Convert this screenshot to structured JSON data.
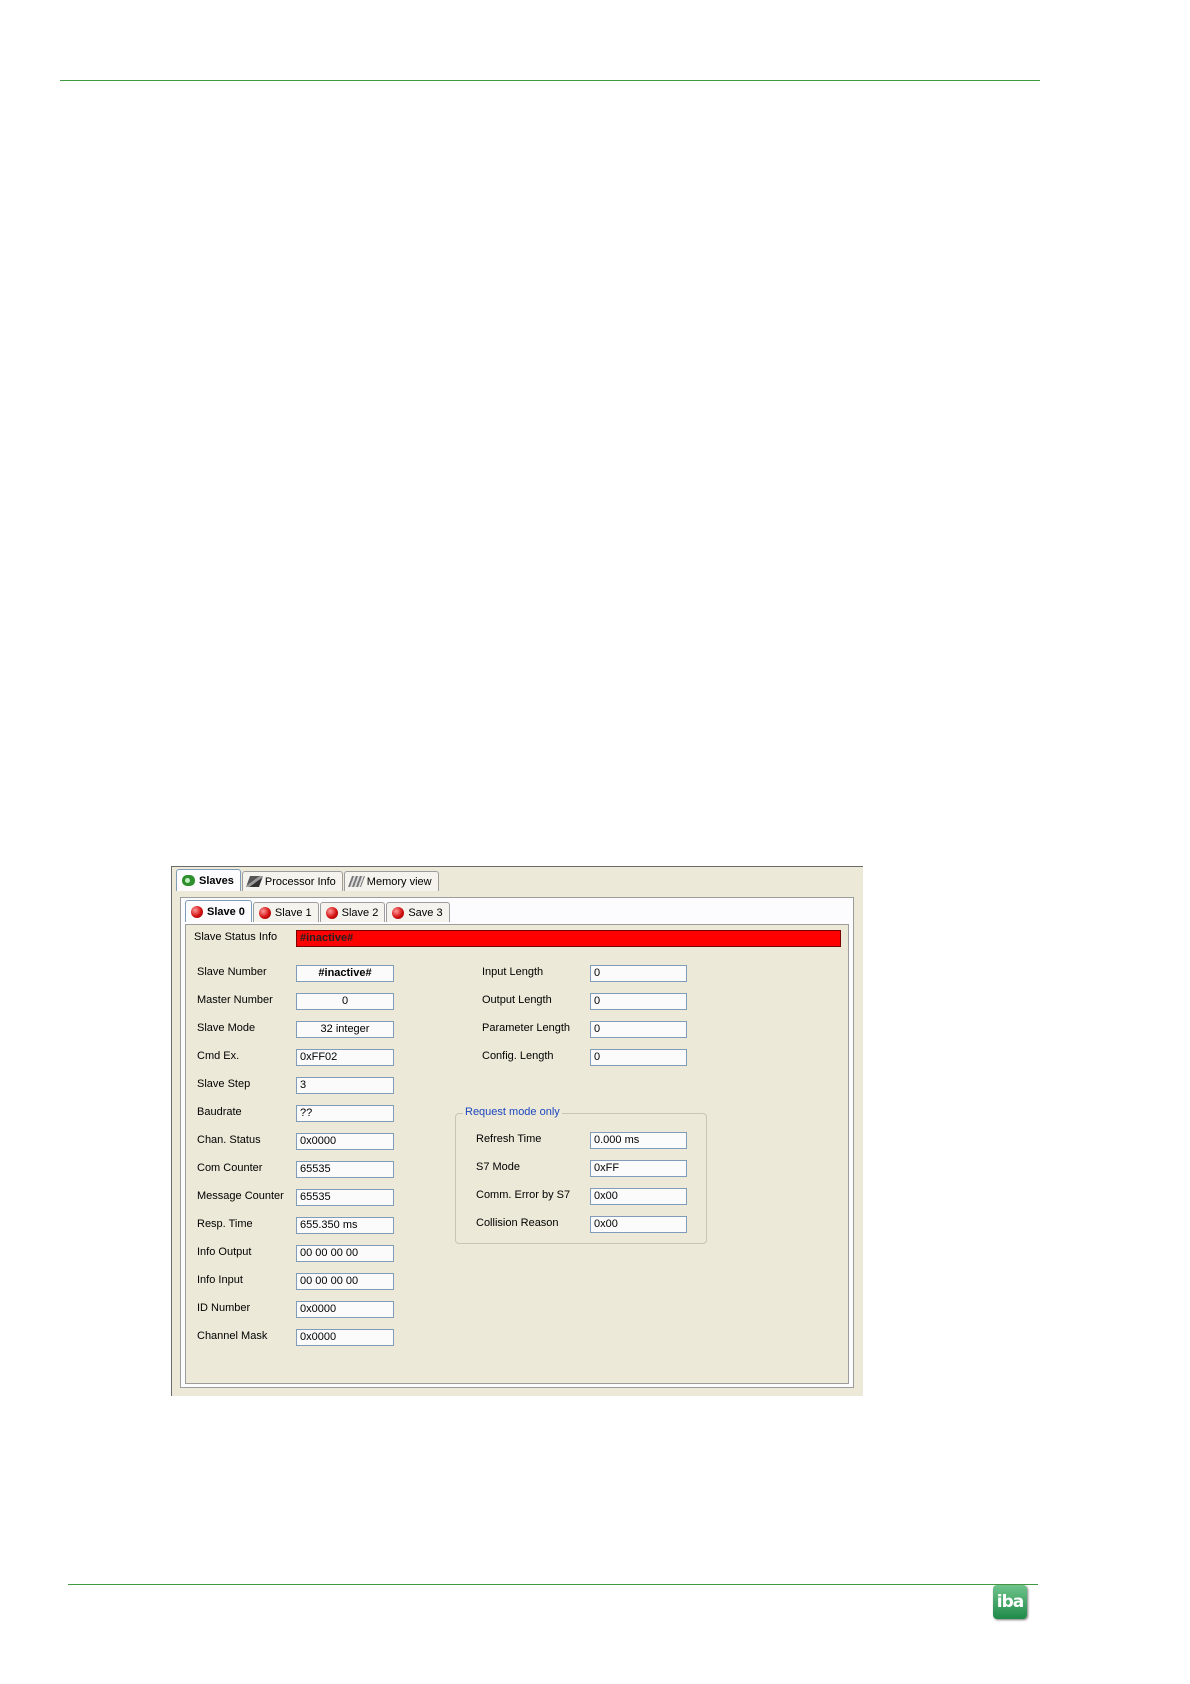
{
  "main_tabs": [
    {
      "label": "Slaves",
      "icon": "slaves-icon",
      "active": true
    },
    {
      "label": "Processor Info",
      "icon": "processor-icon",
      "active": false
    },
    {
      "label": "Memory view",
      "icon": "memory-icon",
      "active": false
    }
  ],
  "slave_tabs": [
    {
      "label": "Slave 0",
      "active": true
    },
    {
      "label": "Slave 1",
      "active": false
    },
    {
      "label": "Slave 2",
      "active": false
    },
    {
      "label": "Save 3",
      "active": false
    }
  ],
  "status": {
    "label": "Slave Status Info",
    "value": "#inactive#",
    "color": "#ff0000"
  },
  "left_fields": [
    {
      "label": "Slave Number",
      "value": "#inactive#"
    },
    {
      "label": "Master Number",
      "value": "0"
    },
    {
      "label": "Slave Mode",
      "value": "32 integer"
    },
    {
      "label": "Cmd Ex.",
      "value": "0xFF02"
    },
    {
      "label": "Slave Step",
      "value": "3"
    },
    {
      "label": "Baudrate",
      "value": "??"
    },
    {
      "label": "Chan. Status",
      "value": "0x0000"
    },
    {
      "label": "Com Counter",
      "value": "65535"
    },
    {
      "label": "Message Counter",
      "value": "65535"
    },
    {
      "label": "Resp. Time",
      "value": "655.350 ms"
    },
    {
      "label": "Info Output",
      "value": "00 00 00 00"
    },
    {
      "label": "Info Input",
      "value": "00 00 00 00"
    },
    {
      "label": "ID Number",
      "value": "0x0000"
    },
    {
      "label": "Channel Mask",
      "value": "0x0000"
    }
  ],
  "right_fields": [
    {
      "label": "Input Length",
      "value": "0"
    },
    {
      "label": "Output Length",
      "value": "0"
    },
    {
      "label": "Parameter Length",
      "value": "0"
    },
    {
      "label": "Config. Length",
      "value": "0"
    }
  ],
  "request_group": {
    "title": "Request mode only",
    "fields": [
      {
        "label": "Refresh Time",
        "value": "0.000 ms"
      },
      {
        "label": "S7 Mode",
        "value": "0xFF"
      },
      {
        "label": "Comm. Error by S7",
        "value": "0x00"
      },
      {
        "label": "Collision Reason",
        "value": "0x00"
      }
    ]
  },
  "logo": {
    "text": "iba"
  }
}
